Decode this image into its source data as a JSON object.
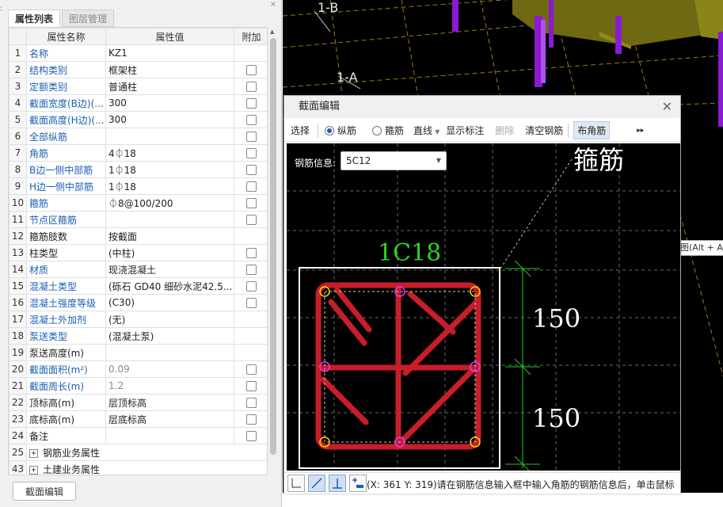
{
  "panel": {
    "tabs": [
      "属性列表",
      "图层管理"
    ],
    "columns": [
      "属性名称",
      "属性值",
      "附加"
    ],
    "rows": [
      {
        "num": "1",
        "name": "名称",
        "value": "KZ1",
        "blue": true,
        "check": false
      },
      {
        "num": "2",
        "name": "结构类别",
        "value": "框架柱",
        "blue": true,
        "check": true
      },
      {
        "num": "3",
        "name": "定额类别",
        "value": "普通柱",
        "blue": true,
        "check": true
      },
      {
        "num": "4",
        "name": "截面宽度(B边)(...",
        "value": "300",
        "blue": true,
        "check": true
      },
      {
        "num": "5",
        "name": "截面高度(H边)(...",
        "value": "300",
        "blue": true,
        "check": true
      },
      {
        "num": "6",
        "name": "全部纵筋",
        "value": "",
        "blue": true,
        "check": true
      },
      {
        "num": "7",
        "name": "角筋",
        "value": "4⏀18",
        "blue": true,
        "check": true
      },
      {
        "num": "8",
        "name": "B边一侧中部筋",
        "value": "1⏀18",
        "blue": true,
        "check": true
      },
      {
        "num": "9",
        "name": "H边一侧中部筋",
        "value": "1⏀18",
        "blue": true,
        "check": true
      },
      {
        "num": "10",
        "name": "箍筋",
        "value": "⏀8@100/200",
        "blue": true,
        "check": true
      },
      {
        "num": "11",
        "name": "节点区箍筋",
        "value": "",
        "blue": true,
        "check": true
      },
      {
        "num": "12",
        "name": "箍筋肢数",
        "value": "按截面",
        "blue": false,
        "check": false
      },
      {
        "num": "13",
        "name": "柱类型",
        "value": "(中柱)",
        "blue": false,
        "check": true
      },
      {
        "num": "14",
        "name": "材质",
        "value": "现浇混凝土",
        "blue": true,
        "check": true
      },
      {
        "num": "15",
        "name": "混凝土类型",
        "value": "(砾石 GD40 细砂水泥42.5...",
        "blue": true,
        "check": true
      },
      {
        "num": "16",
        "name": "混凝土强度等级",
        "value": "(C30)",
        "blue": true,
        "check": true
      },
      {
        "num": "17",
        "name": "混凝土外加剂",
        "value": "(无)",
        "blue": true,
        "check": false
      },
      {
        "num": "18",
        "name": "泵送类型",
        "value": "(混凝土泵)",
        "blue": true,
        "check": false
      },
      {
        "num": "19",
        "name": "泵送高度(m)",
        "value": "",
        "blue": false,
        "check": false
      },
      {
        "num": "20",
        "name": "截面面积(m²)",
        "value": "0.09",
        "blue": true,
        "check": true,
        "gray": true
      },
      {
        "num": "21",
        "name": "截面周长(m)",
        "value": "1.2",
        "blue": true,
        "check": true,
        "gray": true
      },
      {
        "num": "22",
        "name": "顶标高(m)",
        "value": "层顶标高",
        "blue": false,
        "check": true
      },
      {
        "num": "23",
        "name": "底标高(m)",
        "value": "层底标高",
        "blue": false,
        "check": true
      },
      {
        "num": "24",
        "name": "备注",
        "value": "",
        "blue": false,
        "check": true
      },
      {
        "num": "25",
        "name": "钢筋业务属性",
        "value": "",
        "blue": false,
        "check": false,
        "group": true
      },
      {
        "num": "43",
        "name": "土建业务属性",
        "value": "",
        "blue": false,
        "check": false,
        "group": true
      }
    ],
    "button": "截面编辑"
  },
  "viewport": {
    "labels": [
      "1-B",
      "1-A"
    ],
    "tooltip": "截图(Alt + A"
  },
  "dialog": {
    "title": "截面编辑",
    "toolbar": {
      "select": "选择",
      "radio_long": "纵筋",
      "radio_stirrup": "箍筋",
      "line": "直线",
      "show_marks": "显示标注",
      "delete": "删除",
      "clear": "清空钢筋",
      "corner": "布角筋"
    },
    "rebar_label": "钢筋信息:",
    "rebar_value": "5C12",
    "canvas_texts": {
      "stirrup_label": "箍筋",
      "top_label": "1C18",
      "dim_top": "150",
      "dim_bottom": "150"
    },
    "status": "(X: 361 Y: 319)请在钢筋信息输入框中输入角筋的钢筋信息后，单击鼠标"
  },
  "colors": {
    "rebar_red": "#c81e2a",
    "dim_green": "#22cc22",
    "label_green": "#2bd22b",
    "link_blue": "#1a5fb4"
  }
}
